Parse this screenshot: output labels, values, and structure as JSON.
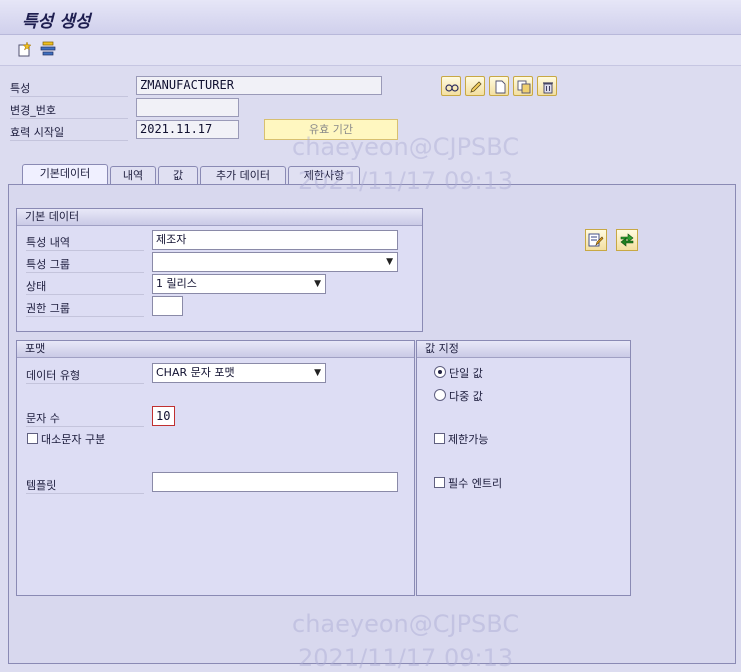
{
  "window": {
    "title": "특성 생성"
  },
  "toolbar": {
    "icons": [
      "new-document-icon",
      "hierarchy-icon"
    ]
  },
  "header": {
    "characteristic_label": "특성",
    "characteristic_value": "ZMANUFACTURER",
    "change_number_label": "변경_번호",
    "change_number_value": "",
    "valid_from_label": "효력 시작일",
    "valid_from_value": "2021.11.17",
    "validity_button": "유효 기간"
  },
  "tabs": [
    {
      "label": "기본데이터",
      "active": true
    },
    {
      "label": "내역",
      "active": false
    },
    {
      "label": "값",
      "active": false
    },
    {
      "label": "추가 데이터",
      "active": false
    },
    {
      "label": "제한사항",
      "active": false
    }
  ],
  "basic_data": {
    "group_title": "기본 데이터",
    "description_label": "특성 내역",
    "description_value": "제조자",
    "group_label": "특성 그룹",
    "group_value": "",
    "status_label": "상태",
    "status_value": "1 릴리스",
    "auth_group_label": "권한 그룹",
    "auth_group_value": ""
  },
  "format": {
    "group_title": "포맷",
    "data_type_label": "데이터 유형",
    "data_type_value": "CHAR 문자 포맷",
    "num_chars_label": "문자 수",
    "num_chars_value": "10",
    "case_sensitive_label": "대소문자 구분",
    "template_label": "템플릿",
    "template_value": ""
  },
  "value_assignment": {
    "group_title": "값 지정",
    "single_value_label": "단일 값",
    "multiple_values_label": "다중 값",
    "restrictable_label": "제한가능",
    "required_entry_label": "필수 엔트리"
  },
  "watermark": {
    "user": "chaeyeon@CJPSBC",
    "datetime": "2021/11/17 09:13"
  },
  "colors": {
    "background": "#dcdcf0",
    "button_yellow": "#f3dfa0"
  }
}
